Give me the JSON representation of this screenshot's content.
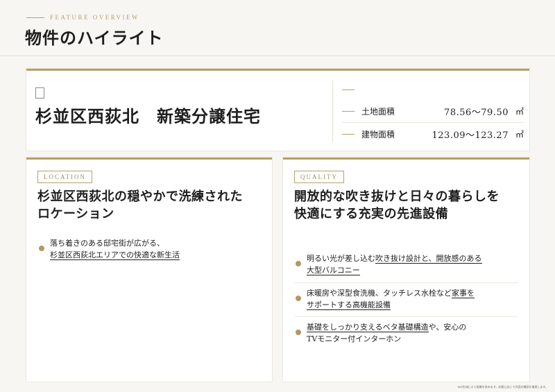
{
  "header": {
    "eyebrow": "FEATURE OVERVIEW",
    "title": "物件のハイライト"
  },
  "hero": {
    "title": "杉並区西荻北　新築分譲住宅",
    "specs": [
      {
        "label": "土地面積",
        "value": "78.56～79.50",
        "unit": "㎡"
      },
      {
        "label": "建物面積",
        "value": "123.09～123.27",
        "unit": "㎡"
      }
    ]
  },
  "location": {
    "tag": "LOCATION",
    "title_lines": [
      "杉並区西荻北の穏やかで洗練された",
      "ロケーション"
    ],
    "items": [
      {
        "line1": "落ち着きのある邸宅街が広がる、",
        "line2": "杉並区西荻北エリアでの快適な新生活"
      }
    ]
  },
  "quality": {
    "tag": "QUALITY",
    "title_lines": [
      "開放的な吹き抜けと日々の暮らしを",
      "快適にする充実の先進設備"
    ],
    "items": [
      {
        "line1_plain": "明るい光が差し込む",
        "line1_ul": "吹き抜け設計と、開放感のある",
        "line2_ul": "大型バルコニー"
      },
      {
        "line1_plain": "床暖房や深型食洗機、タッチレス水栓など",
        "line1_ul": "家事を",
        "line2_ul": "サポートする高機能設備"
      },
      {
        "line1_ul": "基礎をしっかり支えるベタ基礎構造",
        "line1_plain": "や、安心の",
        "line2_plain": "TVモニター付インターホン"
      }
    ]
  },
  "footnote": "※AI生成により画像を含みます。必要に応じて内容の確認を推奨します。"
}
